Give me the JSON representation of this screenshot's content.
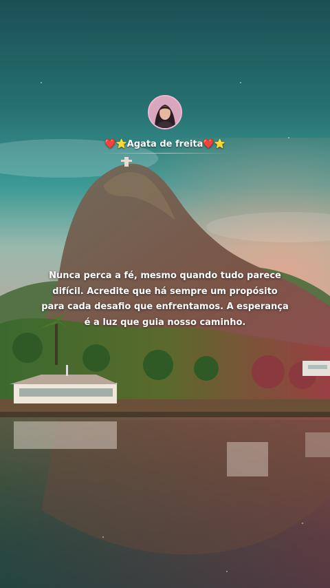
{
  "profile": {
    "username": "❤️⭐Agata de freita❤️⭐",
    "avatar_icon": "profile-photo"
  },
  "quote": {
    "text": "Nunca perca a fé, mesmo quando tudo parece difícil. Acredite que há sempre um propósito para cada desafio que enfrentamos. A esperança é a luz que guia nosso caminho."
  },
  "colors": {
    "sky_top": "#1f6b66",
    "sky_mid": "#2f8a86",
    "horizon_glow": "#d98a7a",
    "mountain": "#6e5548",
    "water": "#2a3a3a",
    "text": "#ffffff"
  }
}
